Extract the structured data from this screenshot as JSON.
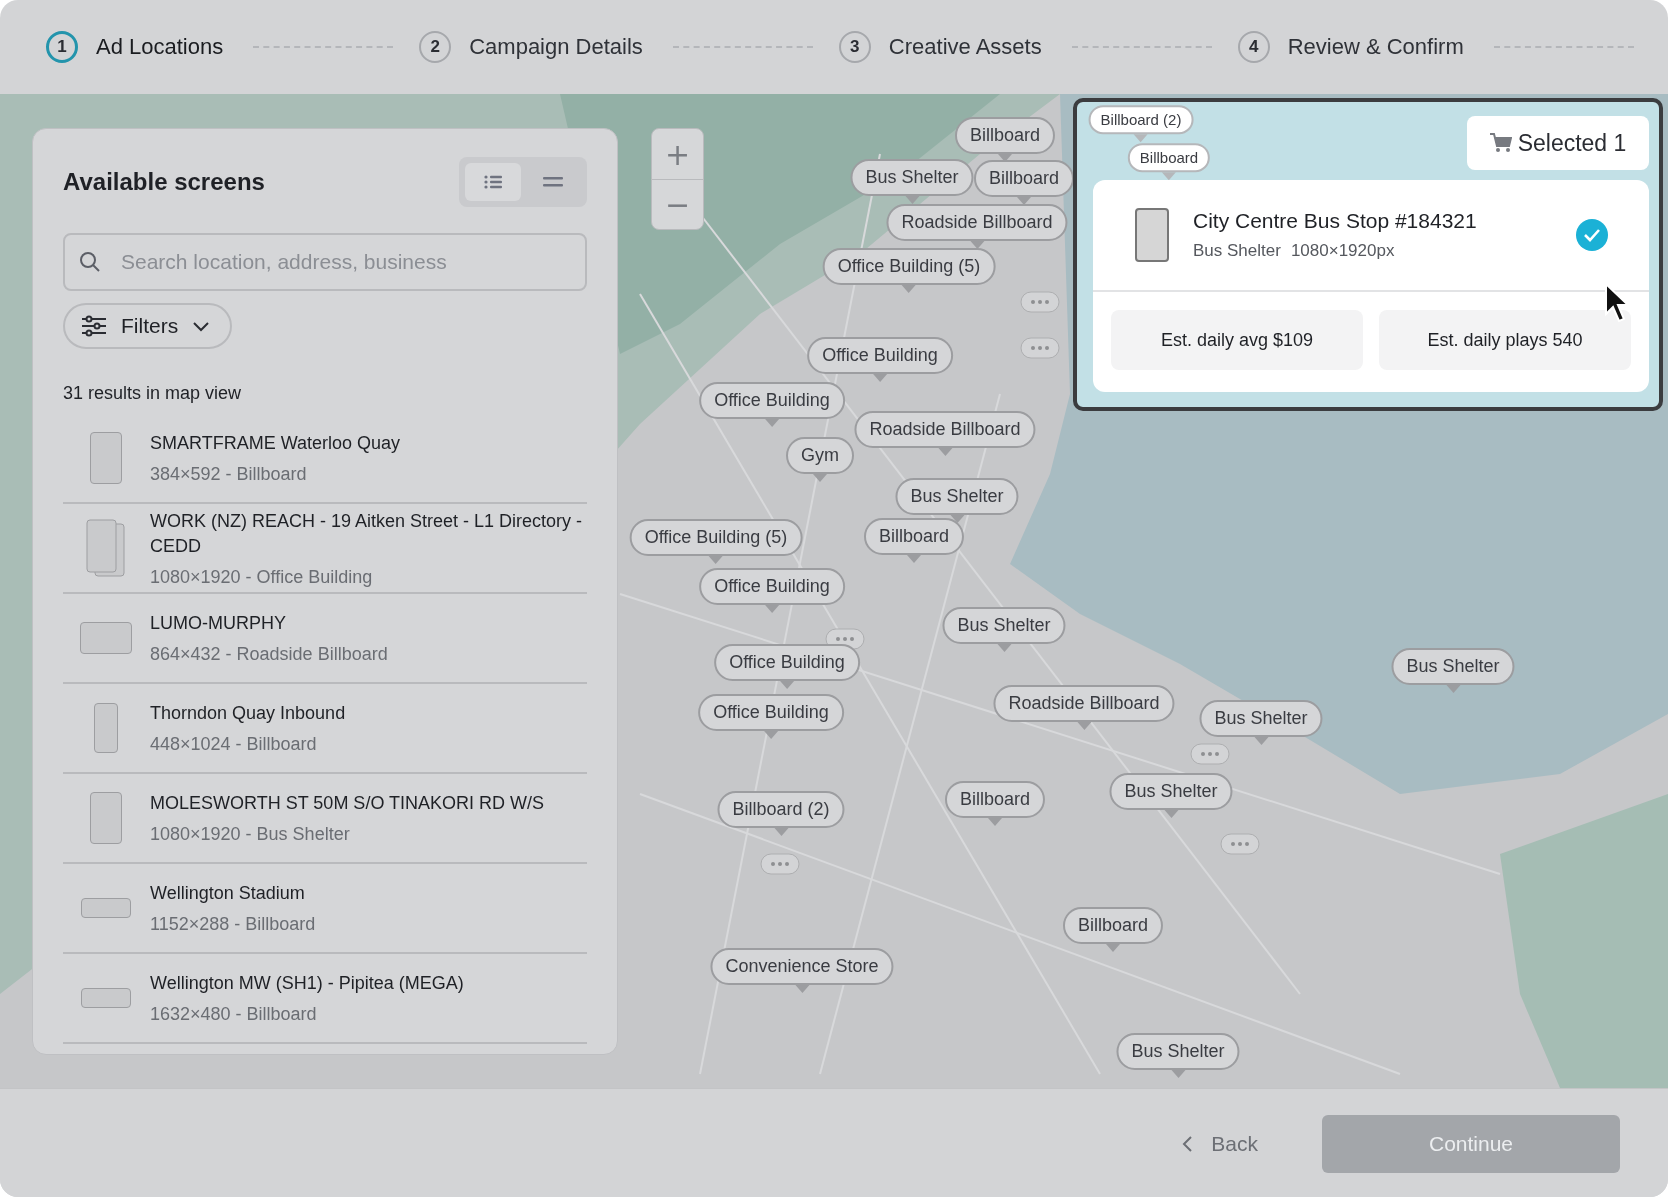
{
  "steps": [
    {
      "number": "1",
      "label": "Ad Locations",
      "selected": true
    },
    {
      "number": "2",
      "label": "Campaign Details",
      "selected": false
    },
    {
      "number": "3",
      "label": "Creative Assets",
      "selected": false
    },
    {
      "number": "4",
      "label": "Review & Confirm",
      "selected": false
    }
  ],
  "panel": {
    "title": "Available screens",
    "view_toggle": [
      {
        "selected": true
      },
      {
        "selected": false
      }
    ],
    "search": {
      "placeholder": "Search location, address, business"
    },
    "filters": "Filters",
    "results": "31 results in map view",
    "screens": [
      {
        "name": "SMARTFRAME Waterloo Quay",
        "details": "384×592 - Billboard",
        "kind": "portrait"
      },
      {
        "name": "WORK (NZ) REACH - 19 Aitken Street - L1 Directory - CEDD",
        "details": "1080×1920 - Office Building",
        "kind": "stack"
      },
      {
        "name": "LUMO-MURPHY",
        "details": "864×432 - Roadside Billboard",
        "kind": "landscape"
      },
      {
        "name": "Thorndon Quay Inbound",
        "details": "448×1024 - Billboard",
        "kind": "narrow"
      },
      {
        "name": "MOLESWORTH ST 50M S/O TINAKORI RD W/S",
        "details": "1080×1920 - Bus Shelter",
        "kind": "portrait"
      },
      {
        "name": "Wellington Stadium",
        "details": "1152×288 - Billboard",
        "kind": "wide"
      },
      {
        "name": "Wellington MW (SH1) - Pipitea (MEGA)",
        "details": "1632×480 - Billboard",
        "kind": "wide"
      }
    ]
  },
  "map": {
    "zoom_in": "+",
    "zoom_out": "−",
    "pins": [
      "Billboard",
      "Bus Shelter",
      "Billboard",
      "Roadside Billboard",
      "Office Building (5)",
      "Office Building",
      "Office Building",
      "Roadside Billboard",
      "Gym",
      "Bus Shelter",
      "Office Building (5)",
      "Billboard",
      "Office Building",
      "Bus Shelter",
      "Office Building",
      "Office Building",
      "Roadside Billboard",
      "Bus Shelter",
      "Bus Shelter",
      "Billboard (2)",
      "Billboard",
      "Bus Shelter",
      "Billboard",
      "Convenience Store",
      "Bus Shelter"
    ]
  },
  "popup": {
    "pins": [
      "Billboard (2)",
      "Billboard"
    ],
    "cart": "Selected 1",
    "screen": {
      "name": "City Centre Bus Stop #184321",
      "type": "Bus Shelter",
      "size": "1080×1920px",
      "selected": true
    },
    "stats": [
      "Est. daily avg $109",
      "Est. daily plays 540"
    ]
  },
  "footer": {
    "back": "Back",
    "continue": {
      "label": "Continue",
      "disabled": true
    }
  }
}
